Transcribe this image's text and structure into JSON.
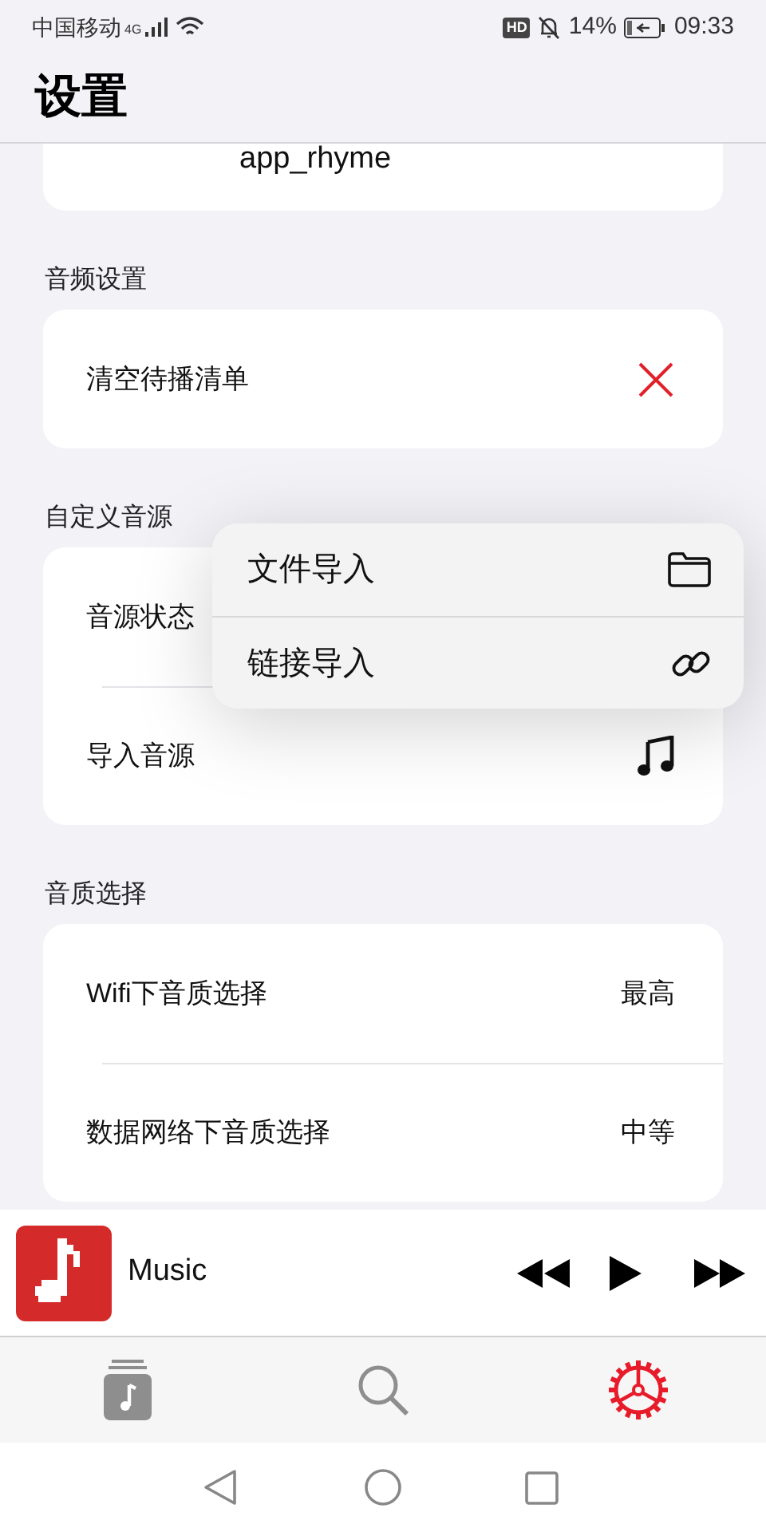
{
  "status_bar": {
    "carrier": "中国移动",
    "network": "4G",
    "hd": "HD",
    "battery": "14%",
    "time": "09:33"
  },
  "header": {
    "title": "设置"
  },
  "top_card": {
    "value": "app_rhyme"
  },
  "sections": [
    {
      "title": "音频设置",
      "rows": [
        {
          "kind": "clear",
          "label": "清空待播清单"
        }
      ]
    },
    {
      "title": "自定义音源",
      "rows": [
        {
          "kind": "plain",
          "label": "音源状态"
        },
        {
          "kind": "music",
          "label": "导入音源"
        }
      ]
    },
    {
      "title": "音质选择",
      "rows": [
        {
          "kind": "value",
          "label": "Wifi下音质选择",
          "value": "最高"
        },
        {
          "kind": "value",
          "label": "数据网络下音质选择",
          "value": "中等"
        }
      ]
    }
  ],
  "popup_menu": {
    "items": [
      {
        "kind": "folder",
        "label": "文件导入"
      },
      {
        "kind": "link",
        "label": "链接导入"
      }
    ]
  },
  "player": {
    "title": "Music"
  },
  "tab_bar": {
    "tabs": [
      {
        "kind": "library",
        "selected": false
      },
      {
        "kind": "search",
        "selected": false
      },
      {
        "kind": "settings",
        "selected": true
      }
    ]
  }
}
